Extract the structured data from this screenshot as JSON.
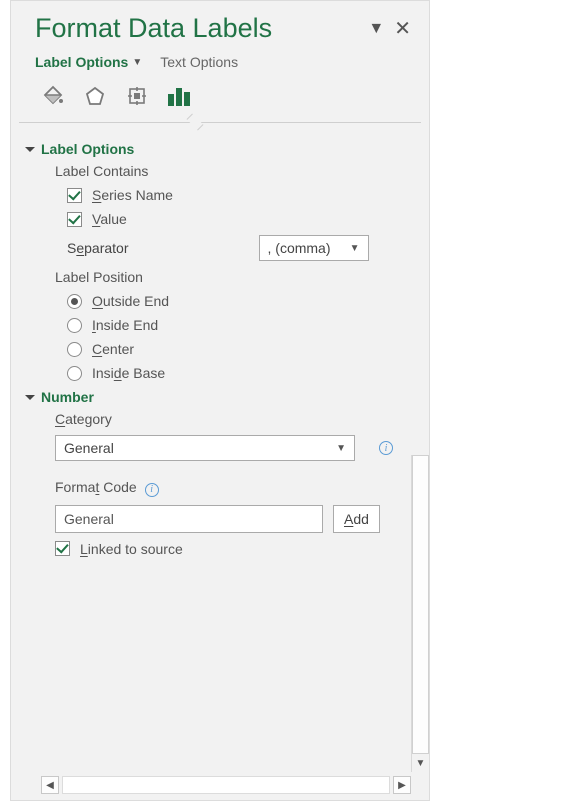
{
  "title": "Format Data Labels",
  "tabs": {
    "label_options": "Label Options",
    "text_options": "Text Options"
  },
  "sections": {
    "label_options": {
      "heading": "Label Options",
      "contains_label": "Label Contains",
      "series_name": "eries Name",
      "series_name_accel": "S",
      "value": "alue",
      "value_accel": "V",
      "separator_label_pre": "S",
      "separator_label_accel": "e",
      "separator_label_post": "parator",
      "separator_value": ", (comma)",
      "position_label": "Label Position",
      "positions": {
        "outside_accel": "O",
        "outside_rest": "utside End",
        "inside_end_accel": "I",
        "inside_end_rest": "nside End",
        "center_accel": "C",
        "center_rest": "enter",
        "inside_base_pre": "Insi",
        "inside_base_accel": "d",
        "inside_base_post": "e Base"
      }
    },
    "number": {
      "heading": "Number",
      "category_accel": "C",
      "category_rest": "ategory",
      "category_value": "General",
      "format_code_pre": "Forma",
      "format_code_accel": "t",
      "format_code_post": " Code",
      "format_code_value": "General",
      "add_accel": "A",
      "add_rest": "dd",
      "linked_accel": "L",
      "linked_rest": "inked to source"
    }
  }
}
